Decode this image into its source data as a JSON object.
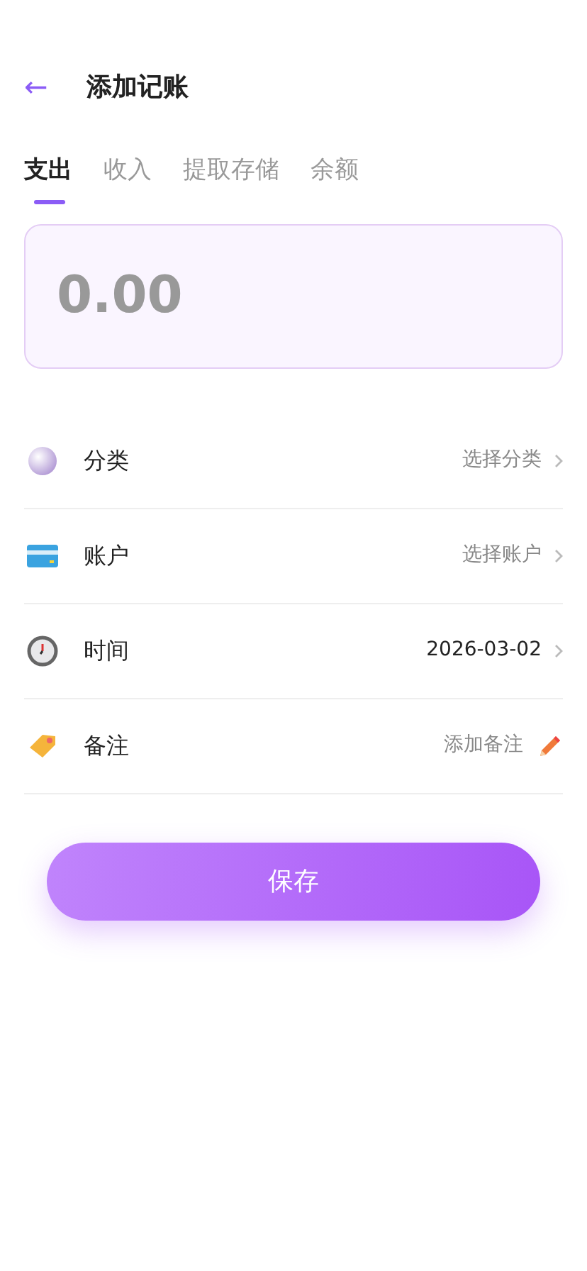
{
  "header": {
    "back": "←",
    "title": "添加记账"
  },
  "tabs": [
    {
      "label": "支出",
      "selected": true
    },
    {
      "label": "收入",
      "selected": false
    },
    {
      "label": "提取存储",
      "selected": false
    },
    {
      "label": "余额",
      "selected": false
    }
  ],
  "amount": {
    "placeholder": "0.00"
  },
  "fields": [
    {
      "kind": "category",
      "label": "分类",
      "placeholder": "选择分类"
    },
    {
      "kind": "account",
      "label": "账户",
      "placeholder": "选择账户"
    },
    {
      "kind": "time",
      "label": "时间",
      "value": "2026-03-02"
    },
    {
      "kind": "note",
      "label": "备注",
      "placeholder": "添加备注"
    }
  ],
  "save_button": "保存"
}
